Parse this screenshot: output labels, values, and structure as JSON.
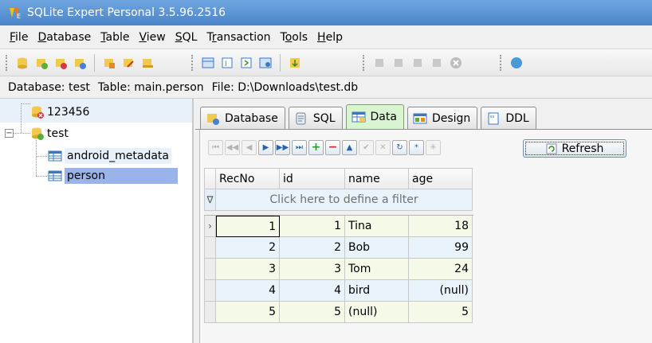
{
  "window": {
    "title": "SQLite Expert Personal 3.5.96.2516"
  },
  "menu": [
    {
      "key": "F",
      "rest": "ile"
    },
    {
      "key": "D",
      "rest": "atabase"
    },
    {
      "key": "T",
      "rest": "able"
    },
    {
      "key": "V",
      "rest": "iew"
    },
    {
      "key": "S",
      "rest": "QL"
    },
    {
      "pre": "T",
      "key": "r",
      "rest": "ansaction"
    },
    {
      "pre": "T",
      "key": "o",
      "rest": "ols"
    },
    {
      "key": "H",
      "rest": "elp"
    }
  ],
  "infobar": {
    "database": "Database: test",
    "table": "Table: main.person",
    "file": "File: D:\\Downloads\\test.db"
  },
  "tree": {
    "nodes": [
      "123456",
      "test",
      "android_metadata",
      "person"
    ]
  },
  "tabs": [
    "Database",
    "SQL",
    "Data",
    "Design",
    "DDL"
  ],
  "active_tab": "Data",
  "refresh_label": "Refresh",
  "grid": {
    "columns": [
      "RecNo",
      "id",
      "name",
      "age"
    ],
    "filter_text": "Click here to define a filter",
    "rows": [
      {
        "recno": "1",
        "id": "1",
        "name": "Tina",
        "age": "18"
      },
      {
        "recno": "2",
        "id": "2",
        "name": "Bob",
        "age": "99"
      },
      {
        "recno": "3",
        "id": "3",
        "name": "Tom",
        "age": "24"
      },
      {
        "recno": "4",
        "id": "4",
        "name": "bird",
        "age": "(null)"
      },
      {
        "recno": "5",
        "id": "5",
        "name": "(null)",
        "age": "5"
      }
    ]
  },
  "colors": {
    "titlebar": "#4a84c9",
    "active_tab": "#d9f4d0",
    "selection": "#9ab3ea",
    "row_green": "#f4f9e8",
    "row_blue": "#e9f3fb"
  }
}
